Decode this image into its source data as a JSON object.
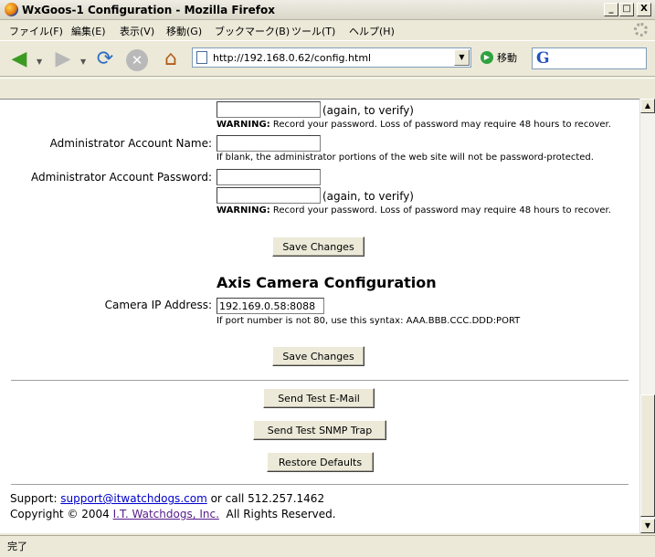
{
  "window": {
    "title": "WxGoos-1 Configuration - Mozilla Firefox",
    "buttons": {
      "min": "_",
      "max": "□",
      "close": "X"
    }
  },
  "menu": [
    "ファイル(F)",
    "編集(E)",
    "表示(V)",
    "移動(G)",
    "ブックマーク(B)",
    "ツール(T)",
    "ヘルプ(H)"
  ],
  "nav": {
    "url": "http://192.168.0.62/config.html",
    "go_label": "移動",
    "search_engine_letter": "G",
    "icons": [
      "back-arrow-icon",
      "forward-arrow-icon",
      "reload-icon",
      "stop-icon",
      "home-icon"
    ]
  },
  "form": {
    "again_verify": "(again, to verify)",
    "warning_bold": "WARNING:",
    "warning_text": " Record your password. Loss of password may require 48 hours to recover.",
    "admin_name_label": "Administrator Account Name:",
    "admin_name_value": "",
    "admin_name_hint": "If blank, the administrator portions of the web site will not be password-protected.",
    "admin_password_label": "Administrator Account Password:",
    "save_label": "Save Changes"
  },
  "camera": {
    "heading": "Axis Camera Configuration",
    "ip_label": "Camera IP Address:",
    "ip_value": "192.169.0.58:8088",
    "ip_hint": "If port number is not 80, use this syntax: AAA.BBB.CCC.DDD:PORT"
  },
  "actions": {
    "test_email": "Send Test E-Mail",
    "test_snmp": "Send Test SNMP Trap",
    "restore": "Restore Defaults"
  },
  "footer": {
    "support_prefix": "Support: ",
    "support_email": "support@itwatchdogs.com",
    "support_suffix": " or call 512.257.1462",
    "copyright_prefix": "Copyright © 2004 ",
    "company": "I.T. Watchdogs, Inc.",
    "copyright_suffix": "  All Rights Reserved."
  },
  "status": {
    "text": "完了"
  }
}
